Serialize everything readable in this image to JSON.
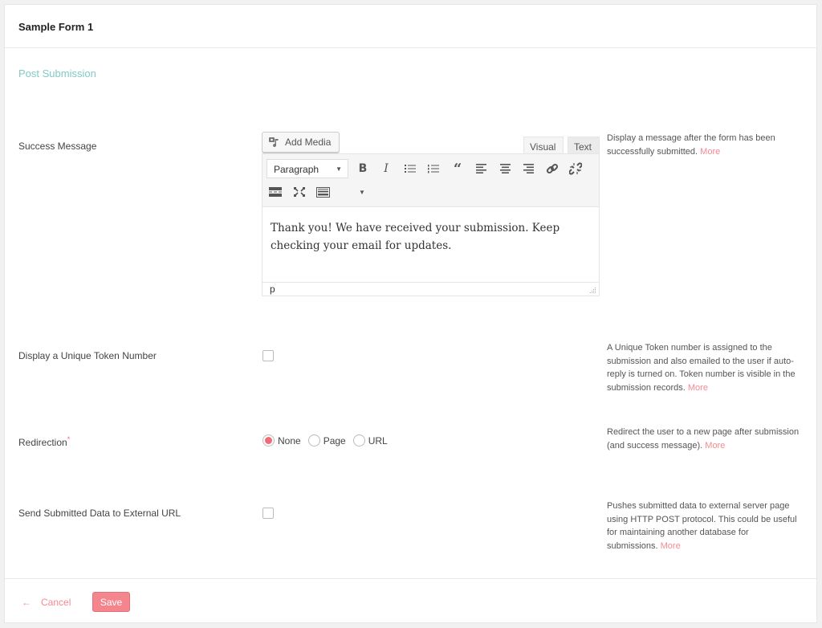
{
  "header": {
    "title": "Sample Form 1"
  },
  "section": {
    "title": "Post Submission"
  },
  "success_message": {
    "label": "Success Message",
    "add_media_label": "Add Media",
    "tabs": {
      "visual": "Visual",
      "text": "Text"
    },
    "format_select": "Paragraph",
    "toolbar_icons": [
      "bold-icon",
      "italic-icon",
      "bulleted-list-icon",
      "numbered-list-icon",
      "blockquote-icon",
      "align-left-icon",
      "align-center-icon",
      "align-right-icon",
      "link-icon",
      "unlink-icon",
      "read-more-icon",
      "fullscreen-icon",
      "keyboard-toolbar-toggle-icon",
      "more-dropdown-icon"
    ],
    "content": "Thank you! We have received your submission. Keep checking your email for updates.",
    "status_path": "p",
    "help": "Display a message after the form has been successfully submitted.",
    "more": "More"
  },
  "unique_token": {
    "label": "Display a Unique Token Number",
    "checked": false,
    "help": "A Unique Token number is assigned to the submission and also emailed to the user if auto-reply is turned on. Token number is visible in the submission records.",
    "more": "More"
  },
  "redirection": {
    "label": "Redirection",
    "required_mark": "*",
    "options": [
      "None",
      "Page",
      "URL"
    ],
    "selected": "None",
    "help": "Redirect the user to a new page after submission (and success message).",
    "more": "More"
  },
  "external_url": {
    "label": "Send Submitted Data to External URL",
    "checked": false,
    "help": "Pushes submitted data to external server page using HTTP POST protocol. This could be useful for maintaining another database for submissions.",
    "more": "More"
  },
  "footer": {
    "cancel_label": "Cancel",
    "cancel_icon": "←",
    "save_label": "Save"
  },
  "colors": {
    "accent": "#f4858d",
    "section_title": "#80cbc4",
    "link": "#f48a92"
  }
}
